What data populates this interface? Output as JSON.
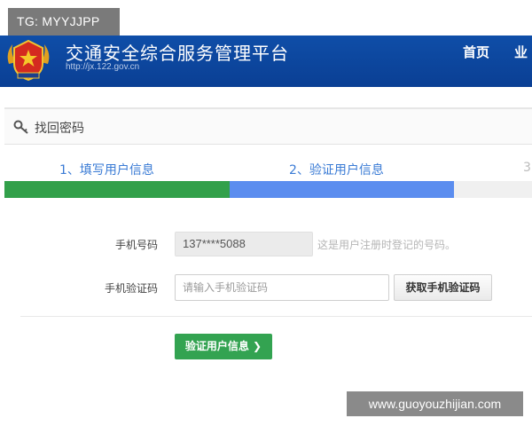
{
  "tag_badge": "TG: MYYJJPP",
  "header": {
    "title": "交通安全综合服务管理平台",
    "url": "http://jx.122.gov.cn",
    "nav": {
      "home": "首页",
      "business": "业"
    }
  },
  "section": {
    "title": "找回密码",
    "icon": "key-icon"
  },
  "steps": [
    "1、填写用户信息",
    "2、验证用户信息",
    "3"
  ],
  "progress": {
    "completed_color": "#32a04a",
    "current_color": "#5b8def"
  },
  "form": {
    "phone_label": "手机号码",
    "phone_value": "137****5088",
    "phone_hint": "这是用户注册时登记的号码。",
    "code_label": "手机验证码",
    "code_placeholder": "请输入手机验证码",
    "get_code_button": "获取手机验证码",
    "submit_button": "验证用户信息 ❯"
  },
  "watermark": "www.guoyouzhijian.com"
}
